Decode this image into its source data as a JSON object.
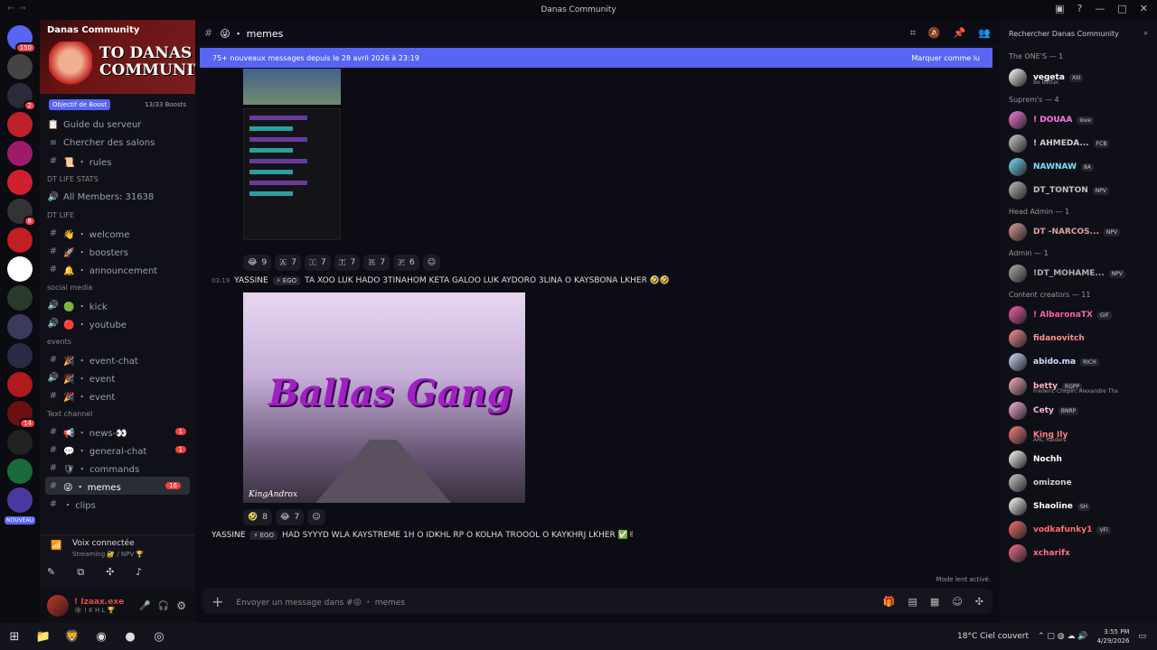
{
  "window": {
    "title": "Danas Community"
  },
  "servers": [
    {
      "badge": "150",
      "color": "#5865f2"
    },
    {
      "badge": "",
      "color": "#444"
    },
    {
      "badge": "2",
      "color": "#2a2a3a"
    },
    {
      "badge": "",
      "color": "#c0202a"
    },
    {
      "badge": "",
      "color": "#a01a6a"
    },
    {
      "badge": "",
      "color": "#d02030"
    },
    {
      "badge": "8",
      "color": "#333"
    },
    {
      "badge": "",
      "color": "#c02020"
    },
    {
      "badge": "",
      "color": "#fff"
    },
    {
      "badge": "",
      "color": "#2a3a2a"
    },
    {
      "badge": "",
      "color": "#3a3a5a"
    },
    {
      "badge": "",
      "color": "#2a2a44"
    },
    {
      "badge": "",
      "color": "#b01a1a"
    },
    {
      "badge": "14",
      "color": "#6a1010"
    },
    {
      "badge": "",
      "color": "#222"
    },
    {
      "badge": "",
      "color": "#1a6a3a"
    },
    {
      "badge": "",
      "color": "#4a3aa0"
    }
  ],
  "server_nouveau": "NOUVEAU",
  "sidebar": {
    "server_name": "Danas Community",
    "banner_text": "TO DANAS COMMUNITY",
    "boost_goal": "Objectif de Boost",
    "boost_count": "13/33 Boosts",
    "items": [
      {
        "type": "link",
        "icon": "📋",
        "label": "Guide du serveur"
      },
      {
        "type": "link",
        "icon": "≡",
        "label": "Chercher des salons"
      },
      {
        "type": "channel",
        "icon": "#",
        "label": "📜 ・ rules"
      },
      {
        "type": "cat",
        "label": "DT LIFE STATS"
      },
      {
        "type": "channel",
        "icon": "🔊",
        "label": "All Members: 31638"
      },
      {
        "type": "cat",
        "label": "DT LIFE"
      },
      {
        "type": "channel",
        "icon": "#",
        "label": "👋 ・ welcome"
      },
      {
        "type": "channel",
        "icon": "#",
        "label": "🚀 ・ boosters"
      },
      {
        "type": "channel",
        "icon": "#",
        "label": "🔔 ・ announcement"
      },
      {
        "type": "cat",
        "label": "social media"
      },
      {
        "type": "channel",
        "icon": "🔊",
        "label": "🟢 ・ kick"
      },
      {
        "type": "channel",
        "icon": "🔊",
        "label": "🔴 ・ youtube"
      },
      {
        "type": "cat",
        "label": "events"
      },
      {
        "type": "channel",
        "icon": "#",
        "label": "🎉 ・ event-chat"
      },
      {
        "type": "channel",
        "icon": "🔊",
        "label": "🎉 ・ event"
      },
      {
        "type": "channel",
        "icon": "#",
        "label": "🎉 ・ event"
      },
      {
        "type": "cat",
        "label": "Text channel"
      },
      {
        "type": "channel",
        "icon": "#",
        "label": "📢 ・ news-👀",
        "badge": "1"
      },
      {
        "type": "channel",
        "icon": "#",
        "label": "💬 ・ general-chat",
        "badge": "1"
      },
      {
        "type": "channel",
        "icon": "#",
        "label": "🛡 ・ commands"
      },
      {
        "type": "channel",
        "icon": "#",
        "label": "😜 ・ memes",
        "badge": "16",
        "active": true
      },
      {
        "type": "channel",
        "icon": "#",
        "label": "・ clips"
      }
    ],
    "voice_title": "Voix connectée",
    "voice_sub": "Streaming 🔐 / NPV 🏆",
    "user_name": "! Izaax.exe",
    "user_status": "🕸 ! K H L 🏆"
  },
  "header": {
    "channel": "😜 ・ memes"
  },
  "newbar": {
    "text": "75+ nouveaux messages depuis le 28 avril 2026 à 23:19",
    "action": "Marquer comme lu"
  },
  "reactions1": [
    {
      "e": "😂",
      "n": "9"
    },
    {
      "e": "🇦",
      "n": "7"
    },
    {
      "e": "🇮",
      "n": "7"
    },
    {
      "e": "🇹",
      "n": "7"
    },
    {
      "e": "🇷",
      "n": "7"
    },
    {
      "e": "🇵",
      "n": "6"
    }
  ],
  "msg1": {
    "time": "03:19",
    "author": "YASSINE",
    "tag": "⚡ EGO",
    "text": "TA XOO LUK HADO 3TINAHOM KETA GALOO LUK AYDORO 3LINA O KAYSBONA LKHER 🤣🤣"
  },
  "image": {
    "title": "Ballas Gang",
    "watermark": "KingAndrox"
  },
  "reactions2": [
    {
      "e": "🤣",
      "n": "8"
    },
    {
      "e": "😂",
      "n": "7"
    }
  ],
  "msg2": {
    "author": "YASSINE",
    "tag": "⚡ EGO",
    "text": "HAD SYYYD WLA KAYSTREME 1H O IDKHL RP O KOLHA TROOOL O KAYKHRJ LKHER ✅✌"
  },
  "slowmode": "Mode lent activé.",
  "input": {
    "placeholder": "Envoyer un message dans #😜 ・ memes"
  },
  "members": {
    "search": "Rechercher Danas Community",
    "groups": [
      {
        "name": "The ONE'S — 1",
        "list": [
          {
            "n": "vegeta",
            "t": "XIII",
            "s": "Be Better.",
            "c": "#ffffff"
          }
        ]
      },
      {
        "name": "Suprem's — 4",
        "list": [
          {
            "n": "! DOUAA",
            "t": "love",
            "s": "",
            "c": "#ff7be5"
          },
          {
            "n": "! AHMEDA...",
            "t": "FCB",
            "s": "",
            "c": "#d0d0d0"
          },
          {
            "n": "NAWNAW",
            "t": "8A",
            "s": "",
            "c": "#7be0ff"
          },
          {
            "n": "DT_TONTON",
            "t": "NPV",
            "s": "",
            "c": "#c0c0c0"
          }
        ]
      },
      {
        "name": "Head Admin — 1",
        "list": [
          {
            "n": "DT -NARCOS...",
            "t": "NPV",
            "s": "",
            "c": "#e0a0a0"
          }
        ]
      },
      {
        "name": "Admin — 1",
        "list": [
          {
            "n": "!DT_MOHAME...",
            "t": "NPV",
            "s": "",
            "c": "#b0b0b0"
          }
        ]
      },
      {
        "name": "Content creators — 11",
        "list": [
          {
            "n": "! AlbaronaTX",
            "t": "GIF",
            "s": "",
            "c": "#ff5fb0"
          },
          {
            "n": "fidanovitch",
            "t": "",
            "s": "",
            "c": "#ff9090"
          },
          {
            "n": "abido.ma",
            "t": "RICH",
            "s": "",
            "c": "#d0e0ff"
          },
          {
            "n": "betty",
            "t": "RGPP",
            "s": "Frédéric Chopin, Alexandre Tha",
            "c": "#ffb0c0"
          },
          {
            "n": "Cety",
            "t": "BNRP",
            "s": "",
            "c": "#ffb0e0"
          },
          {
            "n": "King Ily",
            "t": "",
            "s": "ARC Raiders",
            "c": "#ff8080"
          },
          {
            "n": "Nochh",
            "t": "",
            "s": "",
            "c": "#ffffff"
          },
          {
            "n": "omizone",
            "t": "",
            "s": "",
            "c": "#d0d0d0"
          },
          {
            "n": "Shaoline",
            "t": "SH",
            "s": "",
            "c": "#ffffff"
          },
          {
            "n": "vodkafunky1",
            "t": "VFI",
            "s": "",
            "c": "#ff7070"
          },
          {
            "n": "xcharifx",
            "t": "",
            "s": "",
            "c": "#ff7090"
          }
        ]
      }
    ]
  },
  "taskbar": {
    "weather": "18°C  Ciel couvert",
    "time": "3:55 PM",
    "date": "4/29/2026"
  }
}
